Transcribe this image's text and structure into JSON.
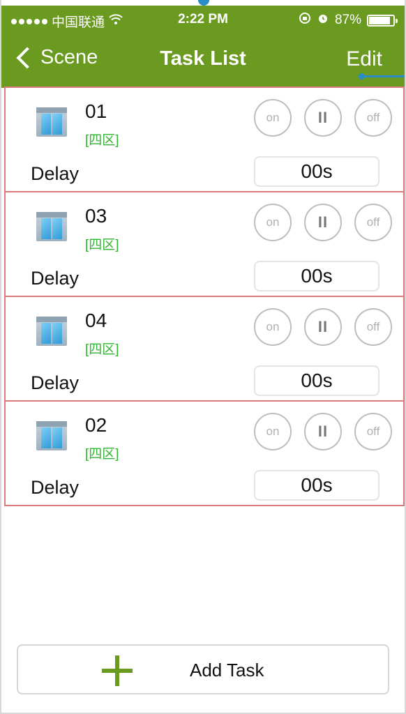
{
  "status_bar": {
    "carrier": "中国联通",
    "wifi_icon": "wifi-icon",
    "time": "2:22 PM",
    "battery": "87%"
  },
  "nav": {
    "back_label": "Scene",
    "title": "Task List",
    "edit_label": "Edit"
  },
  "tasks": [
    {
      "name": "01",
      "zone": "[四区]",
      "on_label": "on",
      "pause_label": "II",
      "off_label": "off",
      "delay_label": "Delay",
      "delay_value": "00s"
    },
    {
      "name": "03",
      "zone": "[四区]",
      "on_label": "on",
      "pause_label": "II",
      "off_label": "off",
      "delay_label": "Delay",
      "delay_value": "00s"
    },
    {
      "name": "04",
      "zone": "[四区]",
      "on_label": "on",
      "pause_label": "II",
      "off_label": "off",
      "delay_label": "Delay",
      "delay_value": "00s"
    },
    {
      "name": "02",
      "zone": "[四区]",
      "on_label": "on",
      "pause_label": "II",
      "off_label": "off",
      "delay_label": "Delay",
      "delay_value": "00s"
    }
  ],
  "add_task": {
    "label": "Add Task"
  },
  "colors": {
    "accent": "#6b9a20",
    "card_border": "#e07a7a",
    "zone_text": "#2fb52f"
  }
}
